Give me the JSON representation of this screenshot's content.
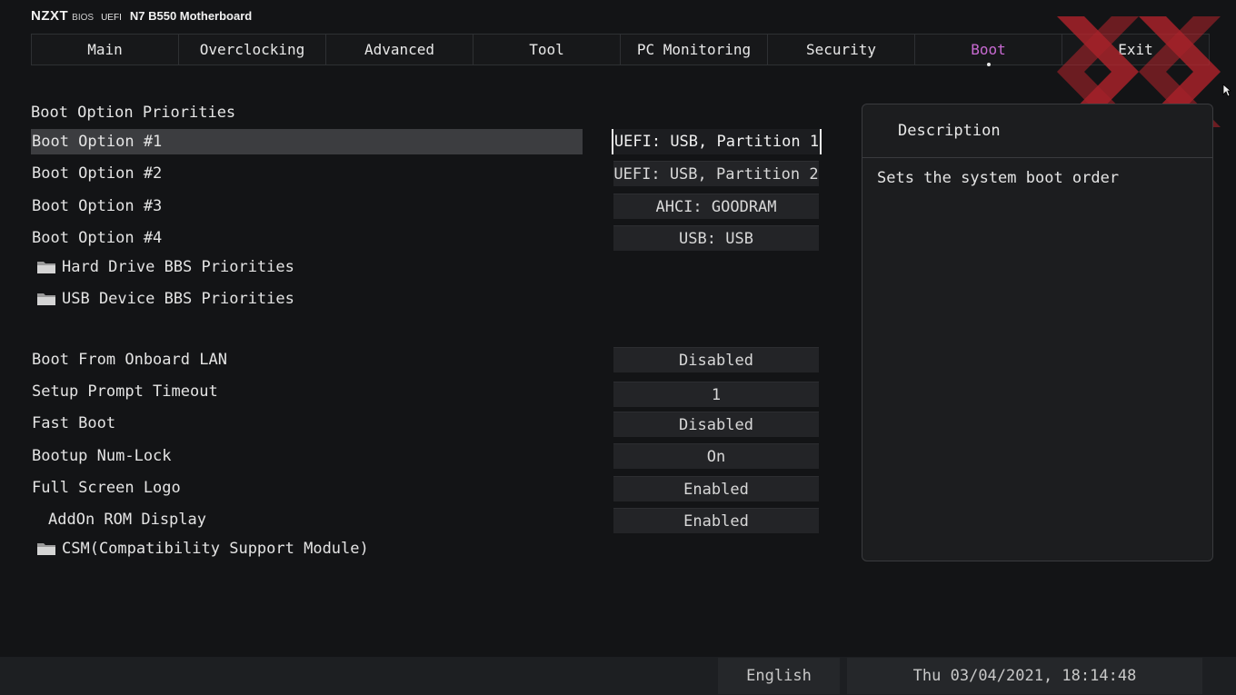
{
  "brand": {
    "logo": "NZXT",
    "bios": "BIOS",
    "uefi": "UEFI",
    "board": "N7 B550 Motherboard"
  },
  "tabs": [
    {
      "label": "Main"
    },
    {
      "label": "Overclocking"
    },
    {
      "label": "Advanced"
    },
    {
      "label": "Tool"
    },
    {
      "label": "PC Monitoring"
    },
    {
      "label": "Security"
    },
    {
      "label": "Boot",
      "active": true
    },
    {
      "label": "Exit"
    }
  ],
  "boot": {
    "section_title": "Boot Option Priorities",
    "options": [
      {
        "label": "Boot Option #1",
        "value": "UEFI:  USB, Partition 1"
      },
      {
        "label": "Boot Option #2",
        "value": "UEFI:  USB, Partition 2"
      },
      {
        "label": "Boot Option #3",
        "value": "AHCI:  GOODRAM"
      },
      {
        "label": "Boot Option #4",
        "value": "USB:  USB"
      }
    ],
    "folders": [
      {
        "label": "Hard Drive BBS Priorities"
      },
      {
        "label": "USB Device BBS Priorities"
      }
    ],
    "settings": [
      {
        "label": "Boot From Onboard LAN",
        "value": "Disabled"
      },
      {
        "label": "Setup Prompt Timeout",
        "value": "1"
      },
      {
        "label": "Fast Boot",
        "value": "Disabled"
      },
      {
        "label": "Bootup Num-Lock",
        "value": "On"
      },
      {
        "label": "Full Screen Logo",
        "value": "Enabled"
      },
      {
        "label": "AddOn ROM Display",
        "value": "Enabled"
      }
    ],
    "csm_folder": {
      "label": "CSM(Compatibility Support Module)"
    }
  },
  "description": {
    "title": "Description",
    "text": "Sets the system boot order"
  },
  "footer": {
    "language": "English",
    "datetime": "Thu 03/04/2021, 18:14:48"
  },
  "colors": {
    "accent": "#c86ad2",
    "background": "#131416",
    "watermark": "#c0252d"
  }
}
